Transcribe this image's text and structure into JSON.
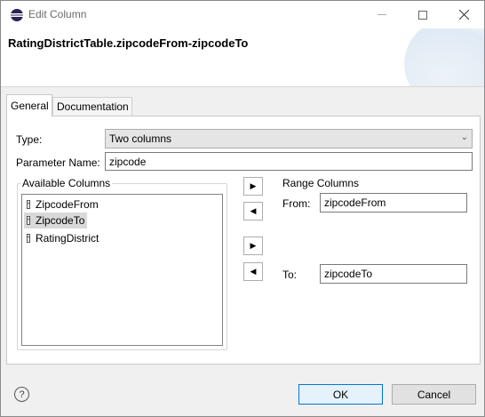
{
  "window": {
    "title": "Edit Column"
  },
  "header": {
    "title": "RatingDistrictTable.zipcodeFrom-zipcodeTo"
  },
  "tabs": [
    {
      "label": "General",
      "active": true
    },
    {
      "label": "Documentation",
      "active": false
    }
  ],
  "form": {
    "type_label": "Type:",
    "type_value": "Two columns",
    "param_label": "Parameter Name:",
    "param_value": "zipcode"
  },
  "available": {
    "label": "Available Columns",
    "items": [
      {
        "label": "ZipcodeFrom",
        "selected": false
      },
      {
        "label": "ZipcodeTo",
        "selected": true
      },
      {
        "label": "RatingDistrict",
        "selected": false
      }
    ]
  },
  "range": {
    "title": "Range Columns",
    "from_label": "From:",
    "from_value": "zipcodeFrom",
    "to_label": "To:",
    "to_value": "zipcodeTo"
  },
  "buttons": {
    "ok": "OK",
    "cancel": "Cancel"
  },
  "colors": {
    "accent": "#0078d7",
    "selected": "#d9d9d9"
  }
}
